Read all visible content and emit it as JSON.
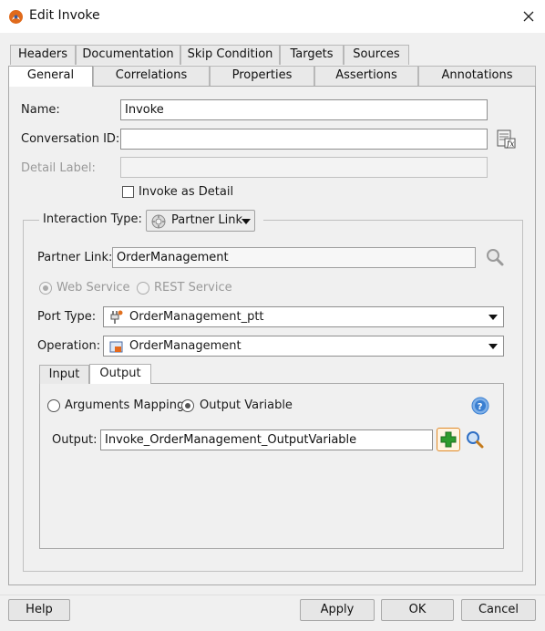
{
  "window": {
    "title": "Edit Invoke",
    "close_icon": "close-icon"
  },
  "tabs_row1": [
    "Headers",
    "Documentation",
    "Skip Condition",
    "Targets",
    "Sources"
  ],
  "tabs_row2": [
    "General",
    "Correlations",
    "Properties",
    "Assertions",
    "Annotations"
  ],
  "general": {
    "name_label": "Name:",
    "name_value": "Invoke",
    "conversation_label": "Conversation ID:",
    "conversation_value": "",
    "detail_label": "Detail Label:",
    "detail_value": "",
    "invoke_as_detail": "Invoke as Detail",
    "invoke_as_detail_checked": false,
    "interaction_type_label": "Interaction Type:",
    "interaction_type_value": "Partner Link",
    "partner_link_label": "Partner Link:",
    "partner_link_value": "OrderManagement",
    "web_service": "Web Service",
    "rest_service": "REST Service",
    "port_type_label": "Port Type:",
    "port_type_value": "OrderManagement_ptt",
    "operation_label": "Operation:",
    "operation_value": "OrderManagement",
    "io_tabs": [
      "Input",
      "Output"
    ],
    "arguments_mapping": "Arguments Mapping",
    "output_variable": "Output Variable",
    "output_label": "Output:",
    "output_value": "Invoke_OrderManagement_OutputVariable"
  },
  "footer": {
    "help": "Help",
    "apply": "Apply",
    "ok": "OK",
    "cancel": "Cancel"
  },
  "colors": {
    "accent": "#2f6fc4",
    "add_green": "#2e9b2e",
    "help_blue": "#3a7fd1"
  }
}
